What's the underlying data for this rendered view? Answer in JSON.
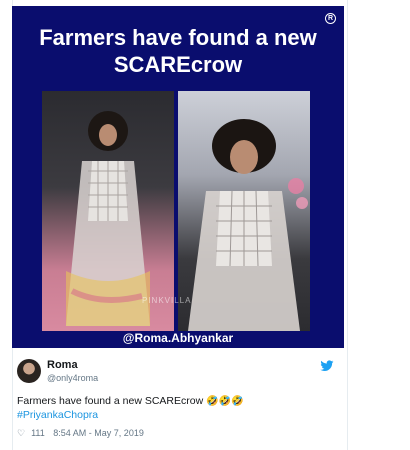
{
  "meme": {
    "title_line1": "Farmers have found a new",
    "title_line2": "SCAREcrow",
    "credit": "@Roma.Abhyankar",
    "watermark": "PINKVILLA",
    "background_color": "#0a0d6e"
  },
  "tweet": {
    "author_name": "Roma",
    "author_handle": "@only4roma",
    "text": "Farmers have found a new SCAREcrow",
    "emoji": "🤣🤣🤣",
    "hashtag": "#PriyankaChopra",
    "like_count": "111",
    "timestamp": "8:54 AM - May 7, 2019",
    "like_icon": "heart-icon",
    "platform_icon": "twitter-bird-icon",
    "accent_color": "#1b95e0"
  }
}
